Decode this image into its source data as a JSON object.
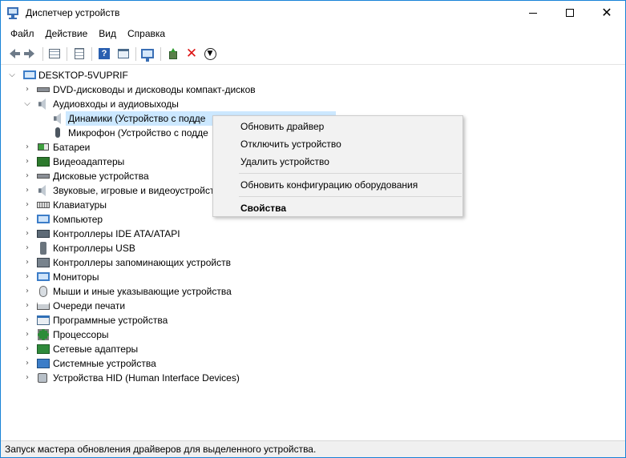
{
  "window": {
    "title": "Диспетчер устройств",
    "accent_color": "#1883d7"
  },
  "menu": [
    "Файл",
    "Действие",
    "Вид",
    "Справка"
  ],
  "toolbar": {
    "icons": [
      "back-icon",
      "forward-icon",
      "show-hide-console-tree-icon",
      "properties-icon",
      "help-icon",
      "action-pane-icon",
      "scan-hardware-icon",
      "update-driver-icon",
      "uninstall-icon",
      "disable-icon"
    ]
  },
  "tree": {
    "root": "DESKTOP-5VUPRIF",
    "items": [
      {
        "label": "DVD-дисководы и дисководы компакт-дисков",
        "icon": "disk-drive-icon",
        "expanded": false
      },
      {
        "label": "Аудиовходы и аудиовыходы",
        "icon": "audio-icon",
        "expanded": true
      },
      {
        "label": "Динамики (Устройство с подде",
        "icon": "speaker-icon",
        "child": true,
        "selected": true
      },
      {
        "label": "Микрофон (Устройство с подде",
        "icon": "microphone-icon",
        "child": true
      },
      {
        "label": "Батареи",
        "icon": "battery-icon",
        "expanded": false
      },
      {
        "label": "Видеоадаптеры",
        "icon": "display-adapter-icon",
        "expanded": false
      },
      {
        "label": "Дисковые устройства",
        "icon": "disk-icon",
        "expanded": false
      },
      {
        "label": "Звуковые, игровые и видеоустройст",
        "icon": "sound-icon",
        "expanded": false
      },
      {
        "label": "Клавиатуры",
        "icon": "keyboard-icon",
        "expanded": false
      },
      {
        "label": "Компьютер",
        "icon": "computer-icon",
        "expanded": false
      },
      {
        "label": "Контроллеры IDE ATA/ATAPI",
        "icon": "ide-icon",
        "expanded": false
      },
      {
        "label": "Контроллеры USB",
        "icon": "usb-icon",
        "expanded": false
      },
      {
        "label": "Контроллеры запоминающих устройств",
        "icon": "storage-controller-icon",
        "expanded": false
      },
      {
        "label": "Мониторы",
        "icon": "monitor-icon",
        "expanded": false
      },
      {
        "label": "Мыши и иные указывающие устройства",
        "icon": "mouse-icon",
        "expanded": false
      },
      {
        "label": "Очереди печати",
        "icon": "printer-icon",
        "expanded": false
      },
      {
        "label": "Программные устройства",
        "icon": "software-device-icon",
        "expanded": false
      },
      {
        "label": "Процессоры",
        "icon": "processor-icon",
        "expanded": false
      },
      {
        "label": "Сетевые адаптеры",
        "icon": "network-adapter-icon",
        "expanded": false
      },
      {
        "label": "Системные устройства",
        "icon": "system-device-icon",
        "expanded": false
      },
      {
        "label": "Устройства HID (Human Interface Devices)",
        "icon": "hid-icon",
        "expanded": false
      }
    ]
  },
  "context_menu": {
    "update_driver": "Обновить драйвер",
    "disable_device": "Отключить устройство",
    "uninstall_device": "Удалить устройство",
    "scan_hardware": "Обновить конфигурацию оборудования",
    "properties": "Свойства"
  },
  "status": "Запуск мастера обновления драйверов для выделенного устройства."
}
